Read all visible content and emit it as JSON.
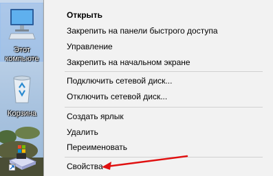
{
  "desktop": {
    "icons": [
      {
        "label_line1": "Этот",
        "label_line2": "компьюте"
      },
      {
        "label": "Корзина"
      },
      {
        "label": ""
      }
    ]
  },
  "context_menu": {
    "groups": [
      [
        "Открыть",
        "Закрепить на панели быстрого доступа",
        "Управление",
        "Закрепить на начальном экране"
      ],
      [
        "Подключить сетевой диск...",
        "Отключить сетевой диск..."
      ],
      [
        "Создать ярлык",
        "Удалить",
        "Переименовать"
      ],
      [
        "Свойства"
      ]
    ]
  },
  "colors": {
    "annotation_arrow": "#e01010",
    "menu_bg": "#f2f2f2"
  }
}
